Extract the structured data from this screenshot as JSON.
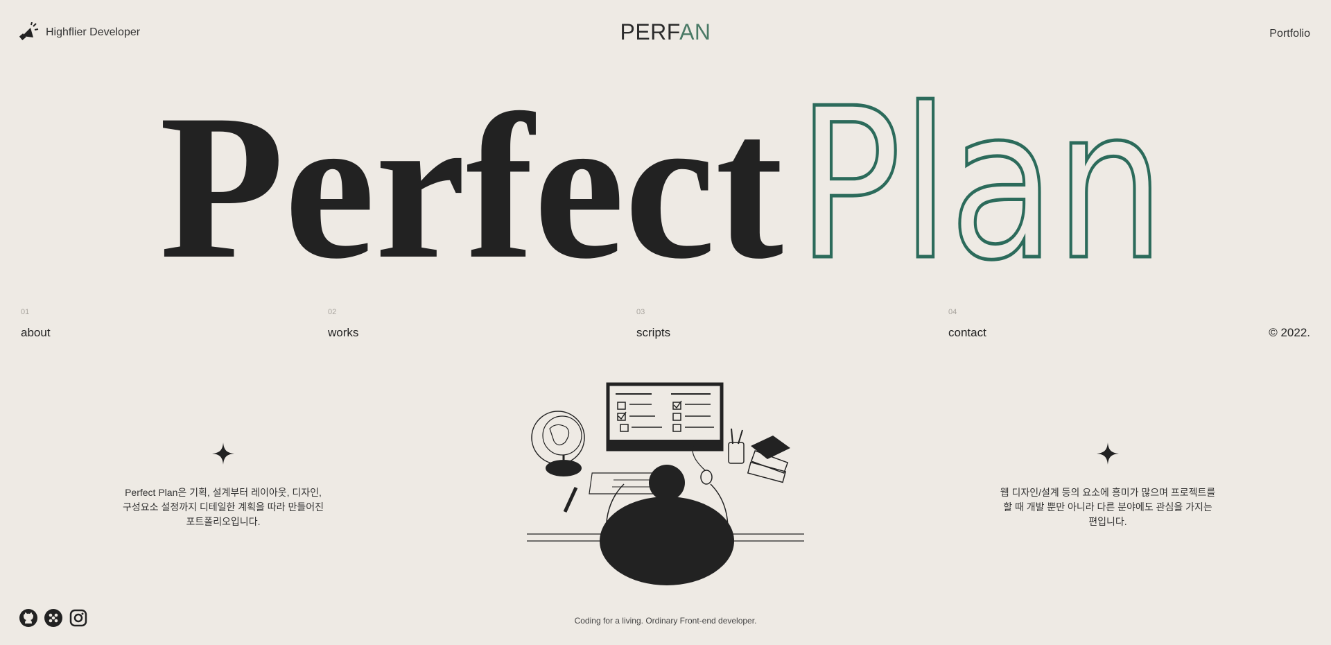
{
  "header": {
    "brand": "Highflier Developer",
    "logo_dark": "PERF",
    "logo_green": "AN",
    "portfolio": "Portfolio"
  },
  "hero": {
    "word1": "Perfect",
    "word2": "Plan"
  },
  "nav": [
    {
      "num": "01",
      "label": "about"
    },
    {
      "num": "02",
      "label": "works"
    },
    {
      "num": "03",
      "label": "scripts"
    },
    {
      "num": "04",
      "label": "contact"
    }
  ],
  "copyright": "© 2022.",
  "left_desc": {
    "line1": "Perfect Plan은 기획, 설계부터 레이아웃, 디자인,",
    "line2": "구성요소 설정까지 디테일한 계획을 따라 만들어진",
    "line3": "포트폴리오입니다."
  },
  "right_desc": {
    "line1": "웹 디자인/설계 등의 요소에 흥미가 많으며 프로젝트를",
    "line2": "할 때 개발 뿐만 아니라 다른 분야에도 관심을 가지는",
    "line3": "편입니다."
  },
  "footer": {
    "tagline": "Coding for a living. Ordinary Front-end developer.",
    "icons": [
      "github-icon",
      "team-icon",
      "instagram-icon"
    ]
  },
  "colors": {
    "background": "#eeeae4",
    "text": "#222222",
    "accent_green": "#2c6b5b"
  }
}
